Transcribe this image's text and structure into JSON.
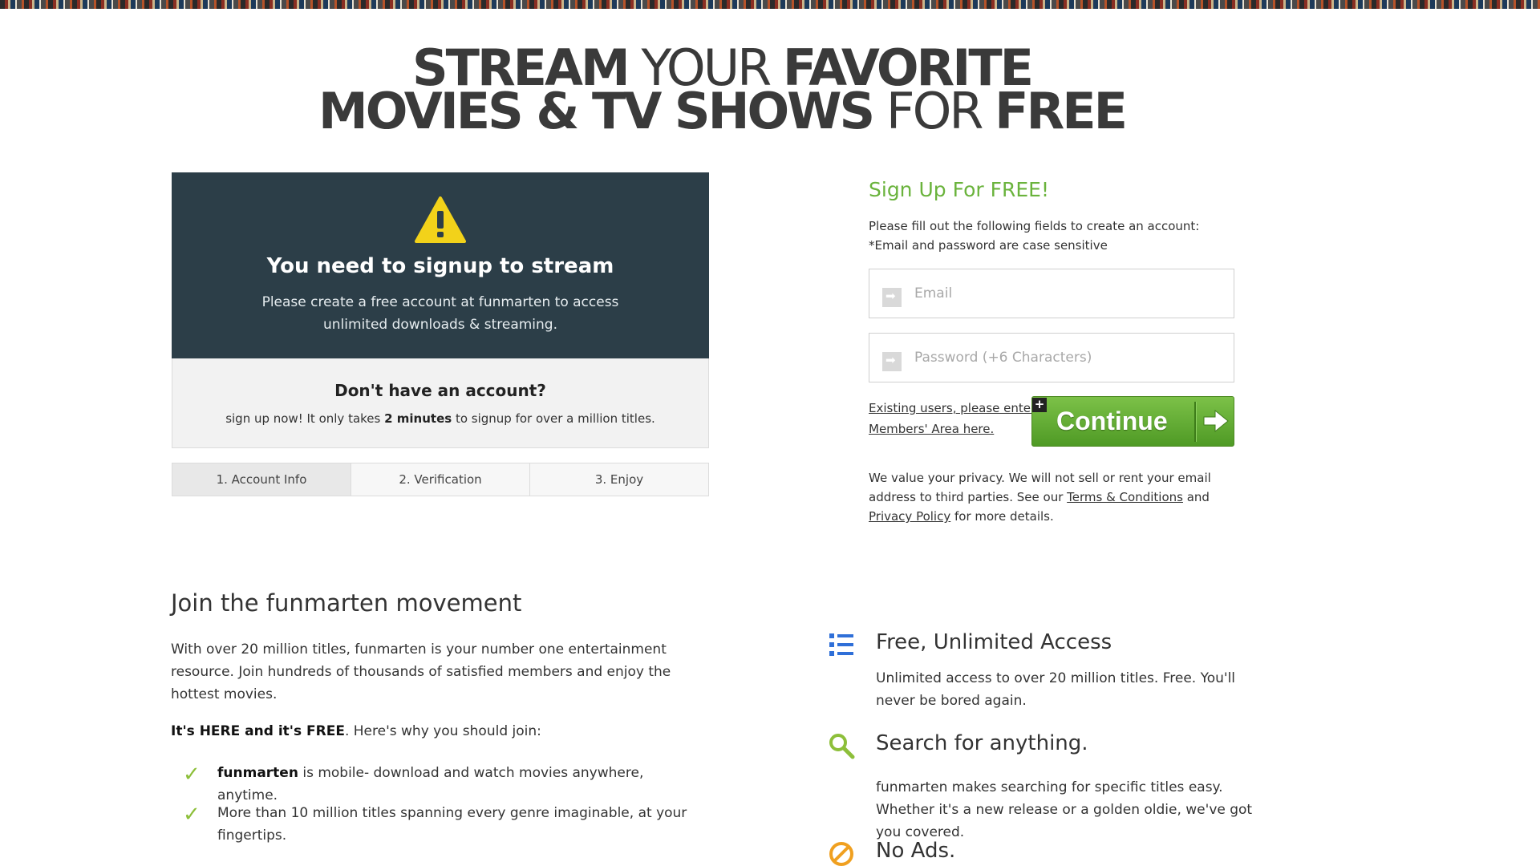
{
  "headline": {
    "line1": [
      {
        "text": "STREAM",
        "weight": "b"
      },
      {
        "text": " YOUR ",
        "weight": "l"
      },
      {
        "text": "FAVORITE",
        "weight": "b"
      }
    ],
    "line2": [
      {
        "text": "MOVIES & TV SHOWS",
        "weight": "b"
      },
      {
        "text": " FOR ",
        "weight": "l"
      },
      {
        "text": "FREE",
        "weight": "b"
      }
    ]
  },
  "alert": {
    "icon": "warning-icon",
    "title": "You need to signup to stream",
    "text": "Please create a free account at funmarten to access unlimited downloads & streaming."
  },
  "account": {
    "title": "Don't have an account?",
    "text_before": "sign up now! It only takes ",
    "text_bold": "2 minutes",
    "text_after": " to signup for over a million titles."
  },
  "steps": [
    "1. Account Info",
    "2. Verification",
    "3. Enjoy"
  ],
  "signup": {
    "title": "Sign Up For FREE!",
    "desc_line1": "Please fill out the following fields to create an account:",
    "desc_line2": "*Email and password are case sensitive",
    "email_placeholder": "Email",
    "password_placeholder": "Password (+6 Characters)",
    "members_link": "Existing users, please enter Members' Area here.",
    "continue_label": "Continue",
    "privacy_before": "We value your privacy. We will not sell or rent your email address to third parties. See our ",
    "terms_link": "Terms & Conditions",
    "privacy_mid": " and ",
    "privacy_link": "Privacy Policy",
    "privacy_after": " for more details."
  },
  "join": {
    "title": "Join the funmarten movement",
    "text": "With over 20 million titles, funmarten is your number one entertainment resource. Join hundreds of thousands of satisfied members and enjoy the hottest movies.",
    "why_bold": "It's HERE and it's FREE",
    "why_rest": ". Here's why you should join:",
    "bullets": [
      {
        "bold": "funmarten",
        "text": " is mobile- download and watch movies anywhere, anytime."
      },
      {
        "bold": "",
        "text": "More than 10 million titles spanning every genre imaginable, at your fingertips."
      }
    ]
  },
  "features": [
    {
      "icon": "list-icon",
      "title": "Free, Unlimited Access",
      "text": "Unlimited access to over 20 million titles. Free. You'll never be bored again."
    },
    {
      "icon": "search-icon",
      "title": "Search for anything.",
      "text": "funmarten makes searching for specific titles easy. Whether it's a new release or a golden oldie, we've got you covered."
    },
    {
      "icon": "no-ads-icon",
      "title": "No Ads.",
      "text": ""
    }
  ],
  "colors": {
    "accent_green": "#6ab33c",
    "panel_dark": "#2c3e48",
    "icon_blue": "#2f6fd8",
    "icon_orange": "#f0a020"
  }
}
